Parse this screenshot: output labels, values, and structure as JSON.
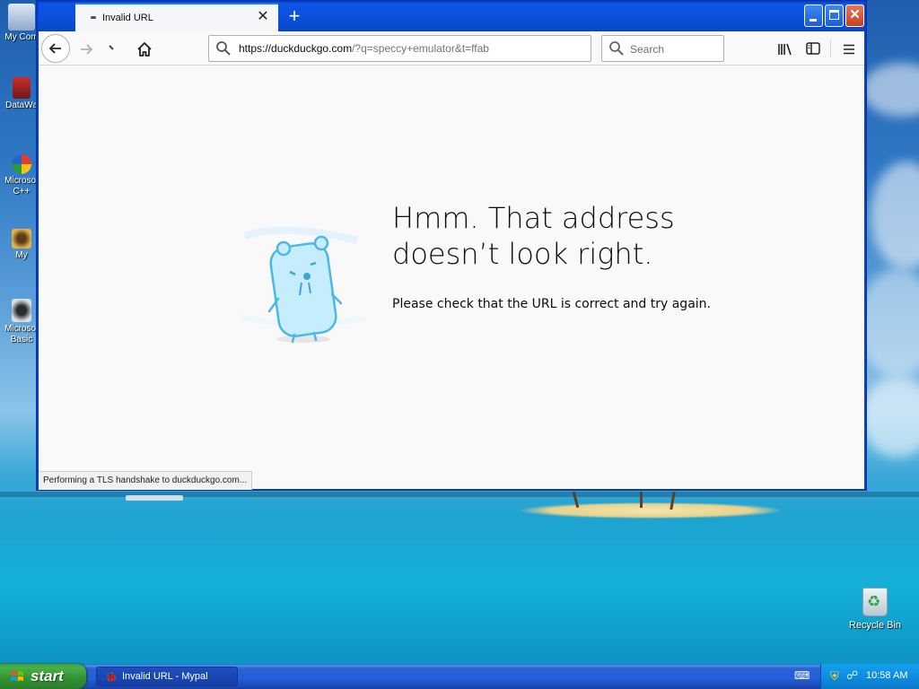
{
  "desktop": {
    "icons": [
      {
        "label": "My Com"
      },
      {
        "label": "DataWa"
      },
      {
        "label": "Microsof C++"
      },
      {
        "label": "My"
      },
      {
        "label": "Microsof Basic"
      }
    ],
    "recycle_label": "Recycle Bin"
  },
  "browser": {
    "tab_title": "Invalid URL",
    "tab_close": "✕",
    "new_tab": "+",
    "url_host": "https://duckduckgo.com",
    "url_path": "/?q=speccy+emulator&t=ffab",
    "search_placeholder": "Search",
    "error_heading": "Hmm. That address doesn’t look right.",
    "error_message": "Please check that the URL is correct and try again.",
    "status_text": "Performing a TLS handshake to duckduckgo.com..."
  },
  "taskbar": {
    "start_label": "start",
    "task_label": "Invalid URL - Mypal",
    "clock": "10:58 AM"
  },
  "icons": {
    "back": "back-arrow-icon",
    "forward": "forward-arrow-icon",
    "home": "home-icon",
    "search": "search-icon",
    "library": "library-icon",
    "sidebar": "sidebar-icon",
    "menu": "hamburger-menu-icon"
  },
  "colors": {
    "window_frame": "#0a3fcf",
    "tab_accent": "#0a84ff",
    "start_button": "#3c9a3c",
    "taskbar": "#245edb"
  }
}
